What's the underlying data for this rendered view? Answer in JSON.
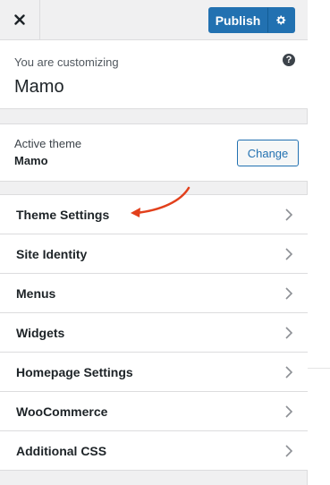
{
  "header": {
    "close_icon": "close-icon",
    "publish_label": "Publish",
    "settings_icon": "gear-icon"
  },
  "customizing": {
    "subtitle": "You are customizing",
    "site_name": "Mamo",
    "help_icon": "help-icon"
  },
  "active_theme": {
    "label": "Active theme",
    "name": "Mamo",
    "change_label": "Change"
  },
  "sections": [
    {
      "label": "Theme Settings"
    },
    {
      "label": "Site Identity"
    },
    {
      "label": "Menus"
    },
    {
      "label": "Widgets"
    },
    {
      "label": "Homepage Settings"
    },
    {
      "label": "WooCommerce"
    },
    {
      "label": "Additional CSS"
    }
  ],
  "colors": {
    "primary_blue": "#2271b1",
    "annotation_red": "#e2401c"
  }
}
